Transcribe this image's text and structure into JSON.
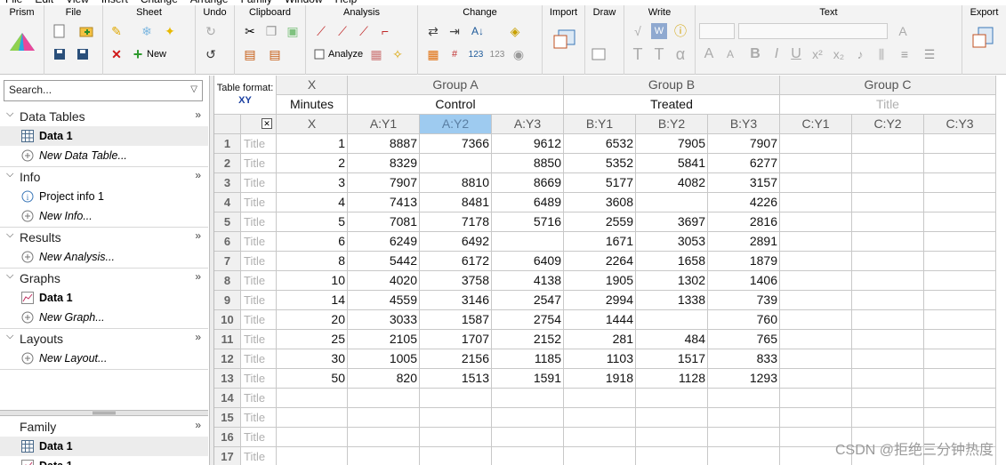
{
  "menubar": [
    "File",
    "Edit",
    "View",
    "Insert",
    "Change",
    "Arrange",
    "Family",
    "Window",
    "Help"
  ],
  "ribbon": {
    "groups": [
      "Prism",
      "File",
      "Sheet",
      "Undo",
      "Clipboard",
      "Analysis",
      "Change",
      "Import",
      "Draw",
      "Write",
      "Text",
      "Export"
    ],
    "new_label": "New",
    "analyze_label": "Analyze"
  },
  "navigator": {
    "search_placeholder": "Search...",
    "sections": [
      {
        "title": "Data Tables",
        "items": [
          {
            "label": "Data 1",
            "selected": true
          },
          {
            "label": "New Data Table...",
            "new": true
          }
        ]
      },
      {
        "title": "Info",
        "items": [
          {
            "label": "Project info 1"
          },
          {
            "label": "New Info...",
            "new": true
          }
        ]
      },
      {
        "title": "Results",
        "items": [
          {
            "label": "New Analysis...",
            "new": true
          }
        ]
      },
      {
        "title": "Graphs",
        "items": [
          {
            "label": "Data 1"
          },
          {
            "label": "New Graph...",
            "new": true
          }
        ]
      },
      {
        "title": "Layouts",
        "items": [
          {
            "label": "New Layout...",
            "new": true
          }
        ]
      }
    ],
    "family": {
      "title": "Family",
      "items": [
        {
          "label": "Data 1"
        },
        {
          "label": "Data 1"
        }
      ]
    }
  },
  "table": {
    "table_format_label": "Table format:",
    "table_format_value": "XY",
    "x_header": "X",
    "x_title": "Minutes",
    "groups": [
      {
        "name": "Group A",
        "title": "Control",
        "cols": [
          "A:Y1",
          "A:Y2",
          "A:Y3"
        ]
      },
      {
        "name": "Group B",
        "title": "Treated",
        "cols": [
          "B:Y1",
          "B:Y2",
          "B:Y3"
        ]
      },
      {
        "name": "Group C",
        "title": "Title",
        "cols": [
          "C:Y1",
          "C:Y2",
          "C:Y3"
        ]
      }
    ],
    "x_subheader": "X",
    "row_title_placeholder": "Title",
    "rows": [
      {
        "n": "1",
        "x": "1",
        "a": [
          "8887",
          "7366",
          "9612"
        ],
        "b": [
          "6532",
          "7905",
          "7907"
        ]
      },
      {
        "n": "2",
        "x": "2",
        "a": [
          "8329",
          "",
          "8850"
        ],
        "b": [
          "5352",
          "5841",
          "6277"
        ]
      },
      {
        "n": "3",
        "x": "3",
        "a": [
          "7907",
          "8810",
          "8669"
        ],
        "b": [
          "5177",
          "4082",
          "3157"
        ]
      },
      {
        "n": "4",
        "x": "4",
        "a": [
          "7413",
          "8481",
          "6489"
        ],
        "b": [
          "3608",
          "",
          "4226"
        ]
      },
      {
        "n": "5",
        "x": "5",
        "a": [
          "7081",
          "7178",
          "5716"
        ],
        "b": [
          "2559",
          "3697",
          "2816"
        ]
      },
      {
        "n": "6",
        "x": "6",
        "a": [
          "6249",
          "6492",
          ""
        ],
        "b": [
          "1671",
          "3053",
          "2891"
        ]
      },
      {
        "n": "7",
        "x": "8",
        "a": [
          "5442",
          "6172",
          "6409"
        ],
        "b": [
          "2264",
          "1658",
          "1879"
        ]
      },
      {
        "n": "8",
        "x": "10",
        "a": [
          "4020",
          "3758",
          "4138"
        ],
        "b": [
          "1905",
          "1302",
          "1406"
        ]
      },
      {
        "n": "9",
        "x": "14",
        "a": [
          "4559",
          "3146",
          "2547"
        ],
        "b": [
          "2994",
          "1338",
          "739"
        ]
      },
      {
        "n": "10",
        "x": "20",
        "a": [
          "3033",
          "1587",
          "2754"
        ],
        "b": [
          "1444",
          "",
          "760"
        ]
      },
      {
        "n": "11",
        "x": "25",
        "a": [
          "2105",
          "1707",
          "2152"
        ],
        "b": [
          "281",
          "484",
          "765"
        ]
      },
      {
        "n": "12",
        "x": "30",
        "a": [
          "1005",
          "2156",
          "1185"
        ],
        "b": [
          "1103",
          "1517",
          "833"
        ]
      },
      {
        "n": "13",
        "x": "50",
        "a": [
          "820",
          "1513",
          "1591"
        ],
        "b": [
          "1918",
          "1128",
          "1293"
        ]
      },
      {
        "n": "14",
        "x": "",
        "a": [
          "",
          "",
          ""
        ],
        "b": [
          "",
          "",
          ""
        ]
      },
      {
        "n": "15",
        "x": "",
        "a": [
          "",
          "",
          ""
        ],
        "b": [
          "",
          "",
          ""
        ]
      },
      {
        "n": "16",
        "x": "",
        "a": [
          "",
          "",
          ""
        ],
        "b": [
          "",
          "",
          ""
        ]
      },
      {
        "n": "17",
        "x": "",
        "a": [
          "",
          "",
          ""
        ],
        "b": [
          "",
          "",
          ""
        ]
      }
    ]
  },
  "watermark": "CSDN @拒绝三分钟热度"
}
